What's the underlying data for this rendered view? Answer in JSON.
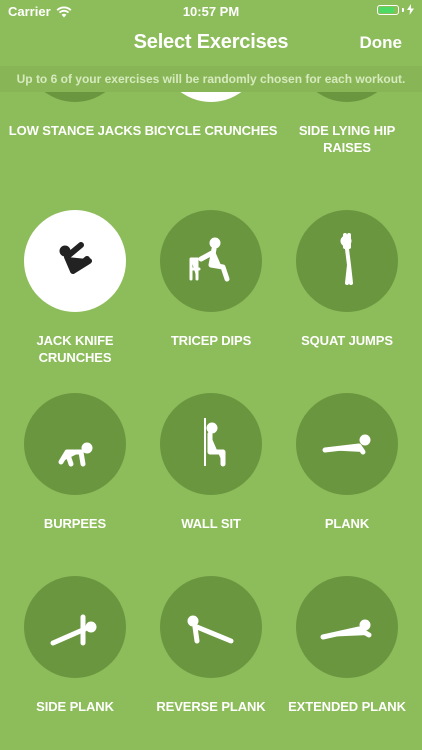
{
  "status_bar": {
    "carrier": "Carrier",
    "time": "10:57 PM"
  },
  "nav": {
    "title": "Select Exercises",
    "done_label": "Done"
  },
  "info_banner": "Up to 6 of your exercises will be randomly chosen for each workout.",
  "exercises": [
    {
      "label": "LOW STANCE JACKS",
      "icon": "low-stance-jacks-icon",
      "selected": false
    },
    {
      "label": "BICYCLE CRUNCHES",
      "icon": "bicycle-crunches-icon",
      "selected": true
    },
    {
      "label": "SIDE LYING HIP RAISES",
      "icon": "side-lying-hip-raises-icon",
      "selected": false
    },
    {
      "label": "JACK KNIFE CRUNCHES",
      "icon": "jack-knife-crunches-icon",
      "selected": true
    },
    {
      "label": "TRICEP DIPS",
      "icon": "tricep-dips-icon",
      "selected": false
    },
    {
      "label": "SQUAT JUMPS",
      "icon": "squat-jumps-icon",
      "selected": false
    },
    {
      "label": "BURPEES",
      "icon": "burpees-icon",
      "selected": false
    },
    {
      "label": "WALL SIT",
      "icon": "wall-sit-icon",
      "selected": false
    },
    {
      "label": "PLANK",
      "icon": "plank-icon",
      "selected": false
    },
    {
      "label": "SIDE PLANK",
      "icon": "side-plank-icon",
      "selected": false
    },
    {
      "label": "REVERSE PLANK",
      "icon": "reverse-plank-icon",
      "selected": false
    },
    {
      "label": "EXTENDED PLANK",
      "icon": "extended-plank-icon",
      "selected": false
    }
  ],
  "colors": {
    "background": "#8dbd5a",
    "circle": "#6b9640",
    "circle_selected": "#ffffff",
    "banner_text": "#d6eabe",
    "battery": "#4cd964"
  }
}
